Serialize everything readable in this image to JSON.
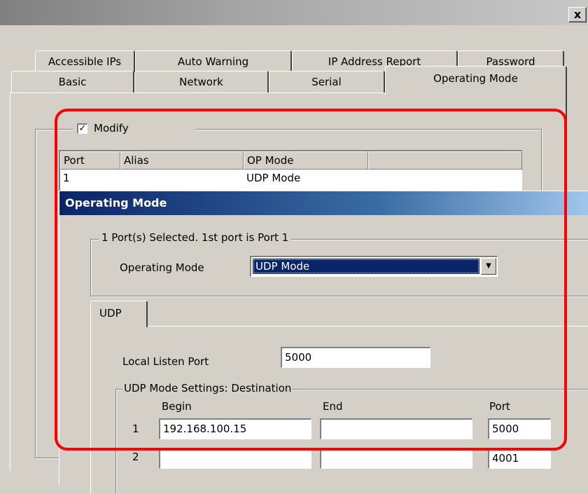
{
  "window": {
    "close_glyph": "x",
    "close_icon": "close-icon"
  },
  "tabs_back": [
    {
      "label": "Accessible IPs"
    },
    {
      "label": "Auto Warning"
    },
    {
      "label": "IP Address Report"
    },
    {
      "label": "Password"
    }
  ],
  "tabs_front": [
    {
      "label": "Basic"
    },
    {
      "label": "Network"
    },
    {
      "label": "Serial"
    },
    {
      "label": "Operating Mode"
    }
  ],
  "modify": {
    "label": "Modify",
    "checked": true,
    "check_glyph": "✓"
  },
  "port_table": {
    "columns": [
      "Port",
      "Alias",
      "OP Mode",
      ""
    ],
    "rows": [
      {
        "port": "1",
        "alias": "",
        "op_mode": "UDP Mode"
      }
    ]
  },
  "dialog": {
    "title": "Operating Mode",
    "selection_text": "1 Port(s) Selected. 1st port is Port 1",
    "operating_mode_label": "Operating Mode",
    "operating_mode_value": "UDP Mode",
    "dropdown_glyph": "▼",
    "tab_label": "UDP",
    "local_listen_port_label": "Local Listen Port",
    "local_listen_port_value": "5000",
    "destination_group_label": "UDP Mode Settings: Destination",
    "destination_columns": {
      "begin": "Begin",
      "end": "End",
      "port": "Port"
    },
    "destinations": [
      {
        "index": "1",
        "begin": "192.168.100.15",
        "end": "",
        "port": "5000"
      },
      {
        "index": "2",
        "begin": "",
        "end": "",
        "port": "4001"
      }
    ]
  },
  "colors": {
    "highlight_frame": "#ff0000",
    "title_active": "#0a246a",
    "face": "#d4d0c8"
  }
}
